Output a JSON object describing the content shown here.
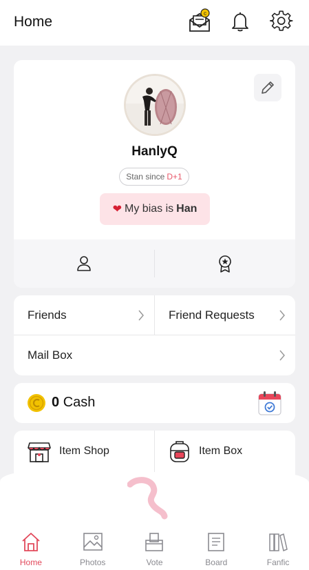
{
  "header": {
    "title": "Home",
    "icons": [
      "mail-coin-icon",
      "bell-icon",
      "gear-icon"
    ]
  },
  "profile": {
    "username": "HanlyQ",
    "stan_since_label": "Stan since",
    "stan_since_value": "D+1",
    "bias_prefix": "My bias is",
    "bias_name": "Han",
    "heart": "❤"
  },
  "menu": {
    "friends": "Friends",
    "friend_requests": "Friend Requests",
    "mail_box": "Mail Box"
  },
  "cash": {
    "amount": "0",
    "label": "Cash"
  },
  "shop": {
    "item_shop": "Item Shop",
    "item_box": "Item Box"
  },
  "tabs": [
    {
      "label": "Home",
      "active": true
    },
    {
      "label": "Photos",
      "active": false
    },
    {
      "label": "Vote",
      "active": false
    },
    {
      "label": "Board",
      "active": false
    },
    {
      "label": "Fanfic",
      "active": false
    }
  ],
  "colors": {
    "accent": "#e2495b",
    "bias_bg": "#fde3e7",
    "coin": "#f2c200",
    "page_bg": "#f1f1f3"
  }
}
